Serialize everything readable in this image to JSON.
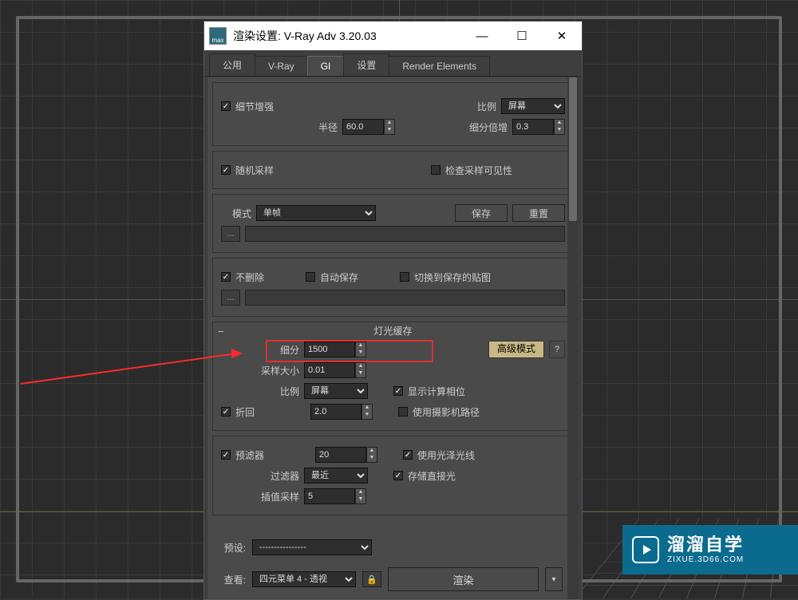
{
  "window": {
    "title": "渲染设置: V-Ray Adv 3.20.03",
    "minimize": "—",
    "maximize": "☐",
    "close": "✕"
  },
  "tabs": [
    "公用",
    "V-Ray",
    "GI",
    "设置",
    "Render Elements"
  ],
  "active_tab": "GI",
  "section1": {
    "detail_enhance": "细节增强",
    "ratio_label": "比例",
    "ratio_value": "屏幕",
    "radius_label": "半径",
    "radius_value": "60.0",
    "subdiv_mult_label": "细分倍增",
    "subdiv_mult_value": "0.3"
  },
  "section2": {
    "random_sample": "随机采样",
    "check_sample_vis": "检查采样可见性"
  },
  "section3": {
    "mode_label": "模式",
    "mode_value": "单帧",
    "save": "保存",
    "reset": "重置",
    "browse": "..."
  },
  "section4": {
    "no_delete": "不删除",
    "auto_save": "自动保存",
    "switch_saved": "切换到保存的贴图",
    "browse": "..."
  },
  "section5": {
    "title": "灯光缓存",
    "subdiv_label": "细分",
    "subdiv_value": "1500",
    "sample_size_label": "采样大小",
    "sample_size_value": "0.01",
    "ratio_label": "比例",
    "ratio_value": "屏幕",
    "show_calc": "显示计算相位",
    "retrace_label": "折回",
    "retrace_value": "2.0",
    "use_camera_path": "使用摄影机路径",
    "adv_mode": "高级模式",
    "q": "?"
  },
  "section6": {
    "prefilter": "预滤器",
    "prefilter_value": "20",
    "use_glossy": "使用光泽光线",
    "filter_label": "过滤器",
    "filter_value": "最近",
    "store_direct": "存储直接光",
    "interp_label": "插值采样",
    "interp_value": "5"
  },
  "footer": {
    "preset_label": "预设:",
    "preset_value": "----------------",
    "view_label": "查看:",
    "view_value": "四元菜单 4 - 透视",
    "render": "渲染",
    "lock": "🔒"
  },
  "watermark": {
    "brand": "溜溜自学",
    "url": "ZIXUE.3D66.COM"
  }
}
